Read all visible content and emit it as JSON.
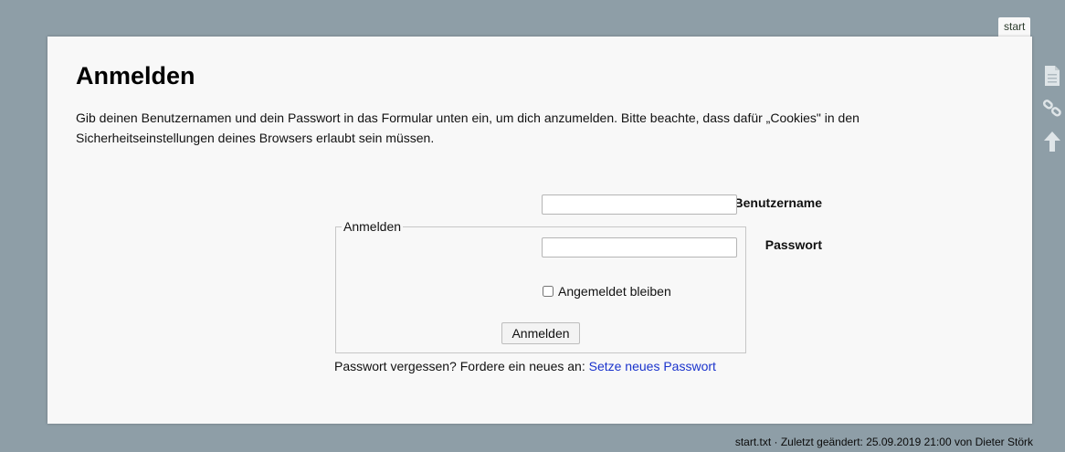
{
  "page_tab": "start",
  "title": "Anmelden",
  "intro": "Gib deinen Benutzernamen und dein Passwort in das Formular unten ein, um dich anzumelden. Bitte beachte, dass dafür „Cookies\" in den Sicherheitseinstellungen deines Browsers erlaubt sein müssen.",
  "form": {
    "legend": "Anmelden",
    "username_label": "Benutzername",
    "username_value": "",
    "password_label": "Passwort",
    "password_value": "",
    "remember_label": "Angemeldet bleiben",
    "remember_checked": false,
    "submit_label": "Anmelden"
  },
  "forgot": {
    "text": "Passwort vergessen? Fordere ein neues an: ",
    "link": "Setze neues Passwort"
  },
  "footer": "start.txt · Zuletzt geändert: 25.09.2019 21:00 von Dieter Störk",
  "page_tools": [
    {
      "icon": "page-icon"
    },
    {
      "icon": "link-icon"
    },
    {
      "icon": "arrow-up-icon"
    }
  ],
  "colors": {
    "background": "#8e9ea7",
    "page": "#f8f8f8",
    "link": "#1a33cc"
  }
}
